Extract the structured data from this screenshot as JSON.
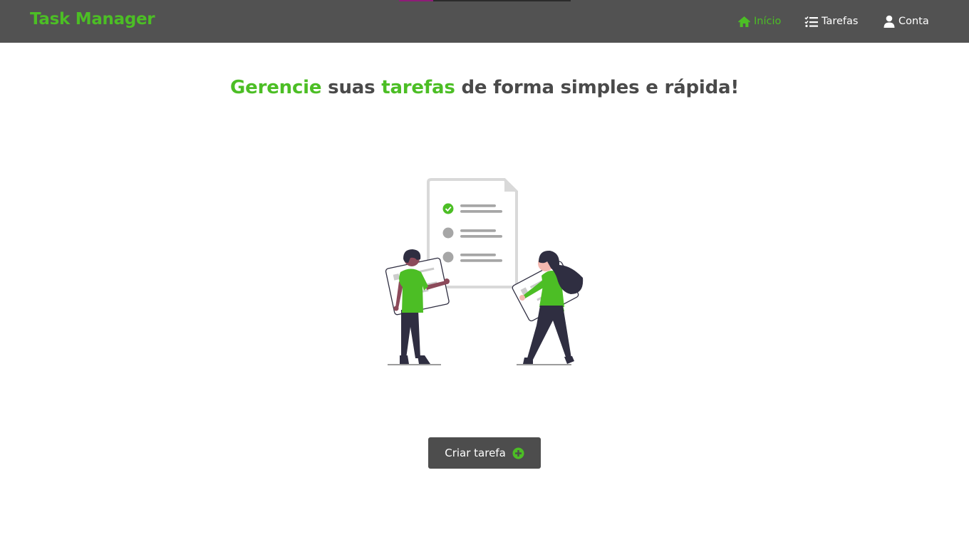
{
  "app": {
    "brand": "Task Manager"
  },
  "progress": {
    "fraction": 0.2
  },
  "nav": {
    "items": [
      {
        "label": "Início",
        "icon": "home-icon",
        "active": true
      },
      {
        "label": "Tarefas",
        "icon": "tasks-list-icon",
        "active": false
      },
      {
        "label": "Conta",
        "icon": "user-icon",
        "active": false
      }
    ]
  },
  "hero": {
    "word1": "Gerencie",
    "text1": " suas ",
    "word2": "tarefas",
    "text2": " de forma simples e rápida!"
  },
  "illustration": {
    "name": "people-with-checklist-illustration"
  },
  "actions": {
    "create_label": "Criar tarefa",
    "create_icon": "plus-circle-icon"
  },
  "colors": {
    "accent": "#4cbe25",
    "navbar": "#525252",
    "button": "#4d4d4d",
    "progress": "#8e1c78",
    "text": "#4a4a4a"
  }
}
